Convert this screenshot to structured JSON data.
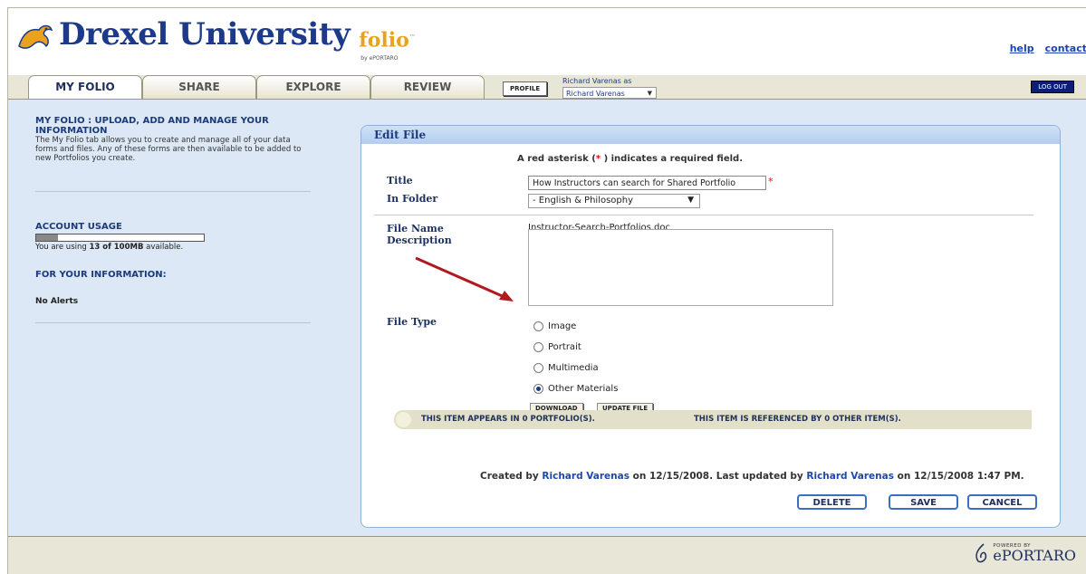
{
  "header": {
    "logo_text": "Drexel University",
    "folio_text": "folio",
    "folio_tm": "™",
    "folio_by": "by ePORTARO",
    "links": [
      "help",
      "contact"
    ]
  },
  "tabs": [
    {
      "label": "MY FOLIO",
      "active": true
    },
    {
      "label": "SHARE",
      "active": false
    },
    {
      "label": "EXPLORE",
      "active": false
    },
    {
      "label": "REVIEW",
      "active": false
    }
  ],
  "toolbar": {
    "profile_label": "PROFILE",
    "as_label": "Richard Varenas as",
    "as_value": "Richard Varenas",
    "logout_label": "LOG OUT"
  },
  "sidebar": {
    "title": "MY FOLIO : UPLOAD, ADD AND MANAGE YOUR INFORMATION",
    "description": "The My Folio tab allows you to create and manage all of your data forms and files. Any of these forms are then available to be added to new Portfolios you create.",
    "usage_title": "ACCOUNT USAGE",
    "usage_fraction": 0.13,
    "usage_prefix": "You are using ",
    "usage_amount": "13 of 100MB",
    "usage_suffix": " available.",
    "info_title": "FOR YOUR INFORMATION:",
    "alerts": "No Alerts"
  },
  "edit": {
    "heading": "Edit File",
    "required_prefix": "A red asterisk (",
    "asterisk": "*",
    "required_suffix": " ) indicates a required field.",
    "title_label": "Title",
    "title_value": "How Instructors can search for Shared Portfolio",
    "folder_label": "In Folder",
    "folder_value": "- English & Philosophy",
    "filename_label": "File Name",
    "filename_value": "Instructor-Search-Portfolios.doc",
    "description_label": "Description",
    "description_value": "",
    "filetype_label": "File Type",
    "file_types": [
      "Image",
      "Portrait",
      "Multimedia",
      "Other Materials"
    ],
    "selected_file_type": "Other Materials",
    "download_label": "DOWNLOAD",
    "update_label": "UPDATE FILE",
    "portfolio_note": "THIS ITEM APPEARS IN 0 PORTFOLIO(S).",
    "reference_note": "THIS ITEM IS REFERENCED BY 0 OTHER ITEM(S).",
    "created_prefix": "Created by ",
    "created_by": "Richard Varenas",
    "created_mid": " on 12/15/2008. Last updated by ",
    "updated_by": "Richard Varenas",
    "updated_suffix": " on 12/15/2008 1:47 PM.",
    "delete_label": "DELETE",
    "save_label": "SAVE",
    "cancel_label": "CANCEL"
  },
  "footer": {
    "powered_by": "POWERED BY",
    "brand": "ePORTARO"
  },
  "colors": {
    "accent": "#1d3a7a",
    "annotation_arrow": "#b0191e",
    "logo_gold": "#e8a21c"
  }
}
